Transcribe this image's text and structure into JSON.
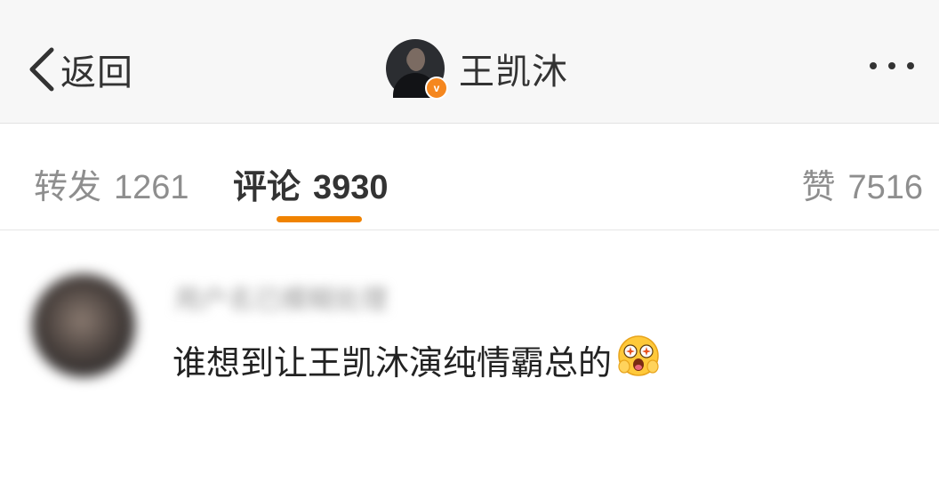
{
  "header": {
    "back_label": "返回",
    "profile_name": "王凯沐",
    "verified_badge": "v",
    "more_icon": "more-horizontal-icon"
  },
  "tabs": {
    "repost": {
      "label": "转发",
      "count": "1261"
    },
    "comment": {
      "label": "评论",
      "count": "3930"
    },
    "likes": {
      "label": "赞",
      "count": "7516"
    },
    "active": "comment",
    "accent_color": "#f08300"
  },
  "comment": {
    "username": "用户名已模糊处理",
    "text": "谁想到让王凯沐演纯情霸总的",
    "emoji": "shocked-face-emoji"
  }
}
